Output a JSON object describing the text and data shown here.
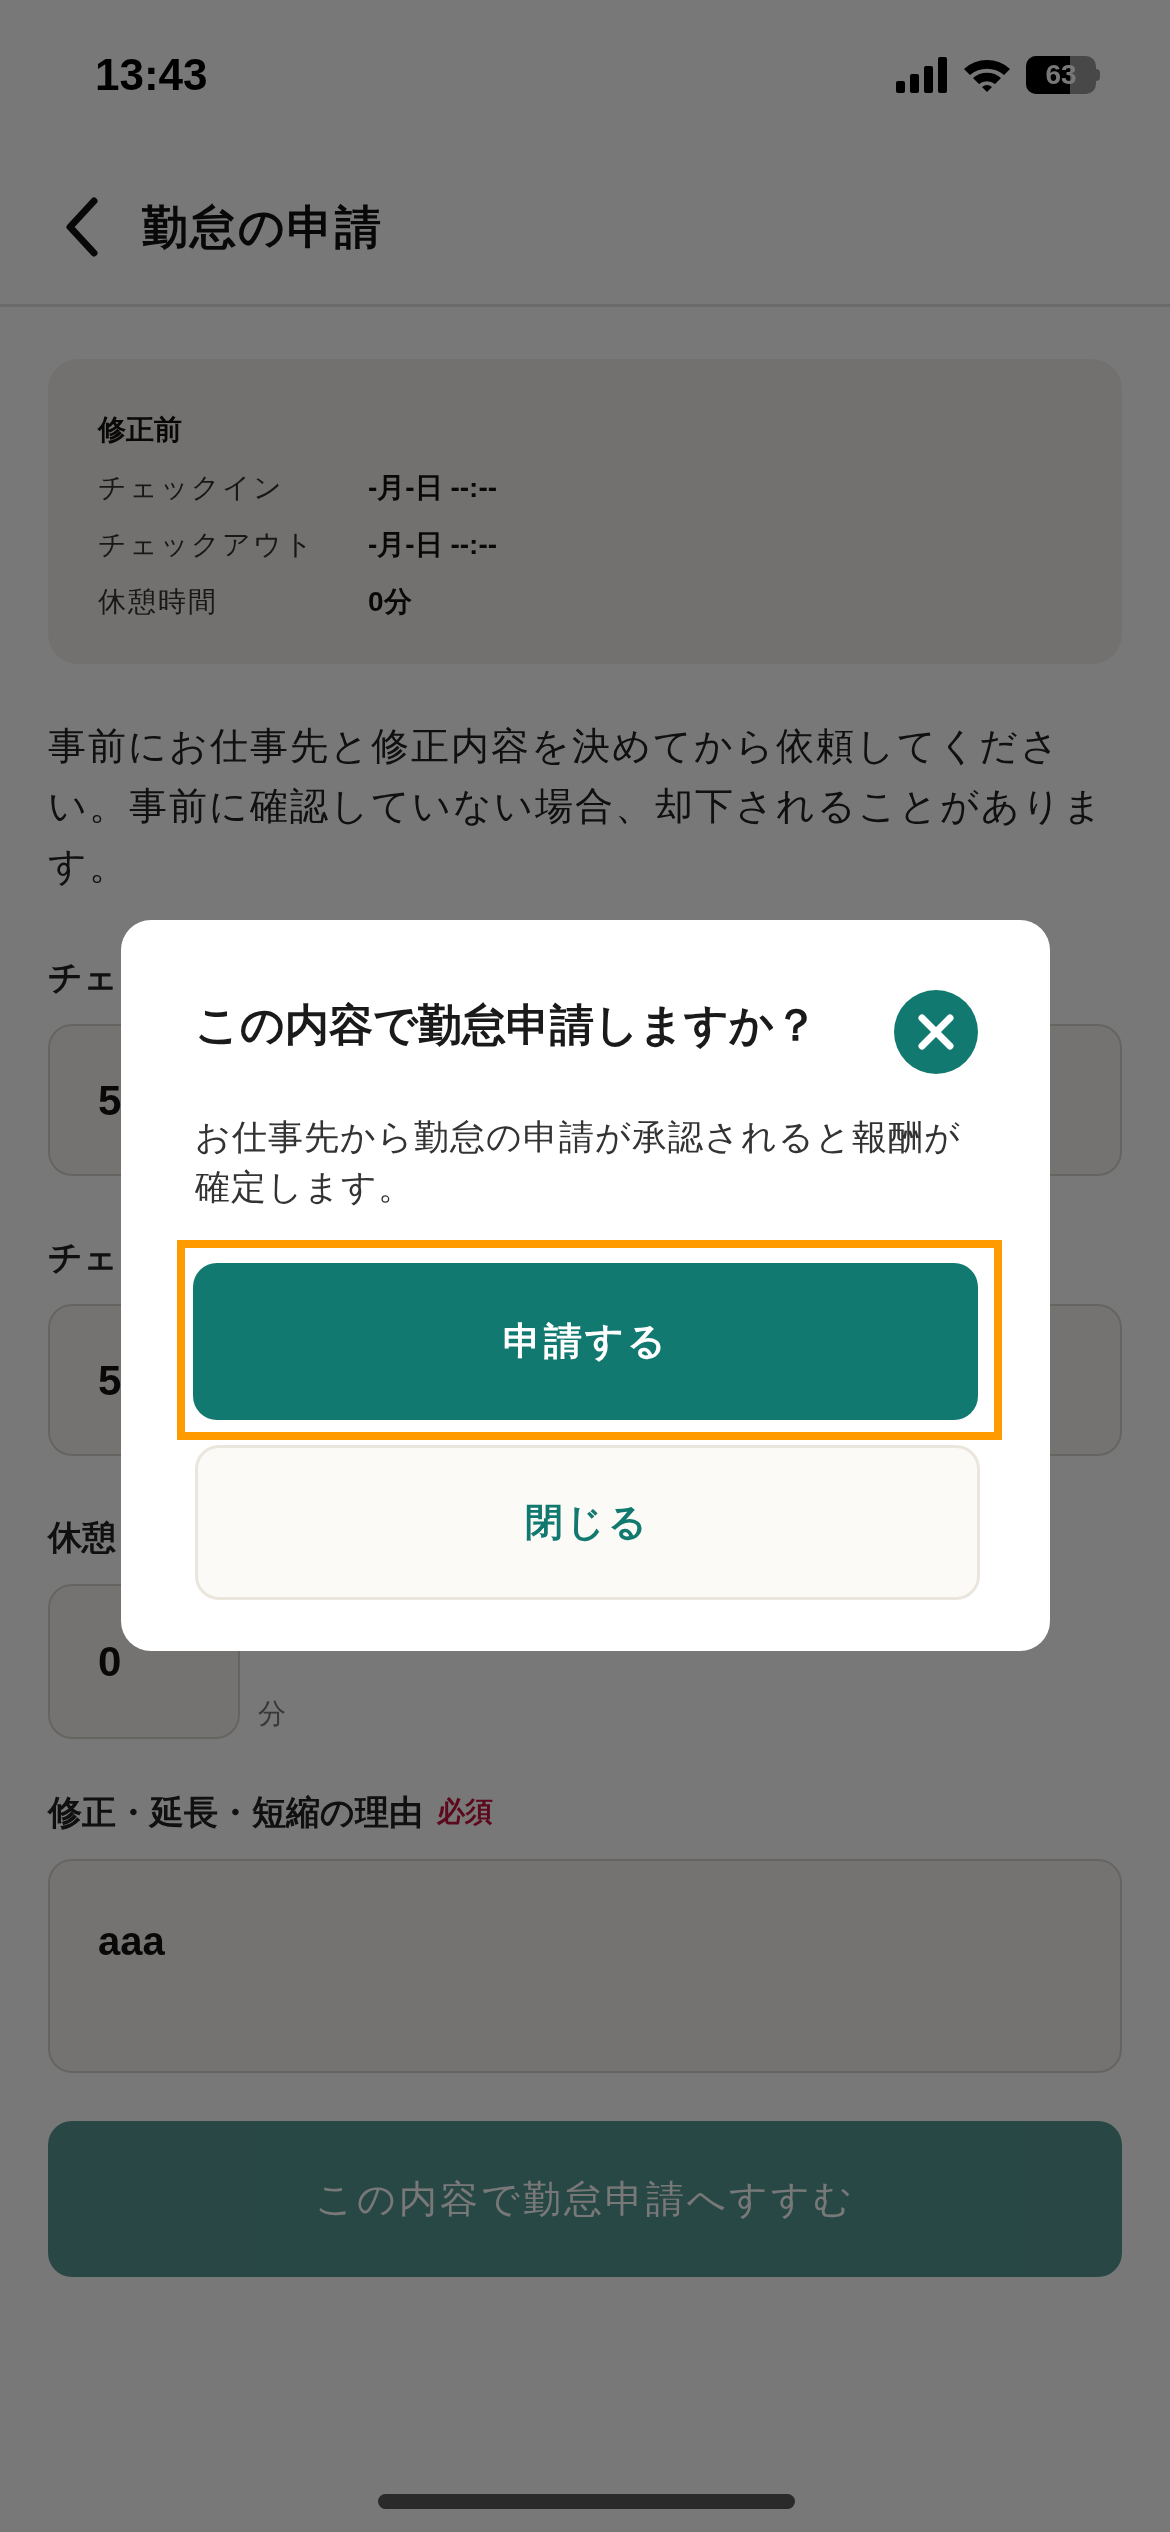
{
  "status_bar": {
    "time": "13:43",
    "battery": "63"
  },
  "header": {
    "title": "勤怠の申請"
  },
  "before_card": {
    "title": "修正前",
    "rows": [
      {
        "label": "チェックイン",
        "value": "-月-日 --:--"
      },
      {
        "label": "チェックアウト",
        "value": "-月-日 --:--"
      },
      {
        "label": "休憩時間",
        "value": "0分"
      }
    ]
  },
  "notice": "事前にお仕事先と修正内容を決めてから依頼してください。事前に確認していない場合、却下されることがあります。",
  "form": {
    "fields": [
      {
        "kind": "datetime",
        "label": "チェ",
        "value": "5"
      },
      {
        "kind": "datetime",
        "label": "チェ",
        "value": "5"
      },
      {
        "kind": "minutes",
        "label": "休憩",
        "value": "0",
        "unit": "分"
      }
    ],
    "reason": {
      "label": "修正・延長・短縮の理由",
      "required_badge": "必須",
      "value": "aaa"
    },
    "submit_button": {
      "label": "この内容で勤怠申請へすすむ"
    }
  },
  "dialog": {
    "title": "この内容で勤怠申請しますか？",
    "message": "お仕事先から勤怠の申請が承認されると報酬が確定します。",
    "actions": [
      {
        "kind": "primary",
        "label": "申請する",
        "highlighted": true
      },
      {
        "kind": "secondary",
        "label": "閉じる",
        "highlighted": false
      }
    ]
  }
}
